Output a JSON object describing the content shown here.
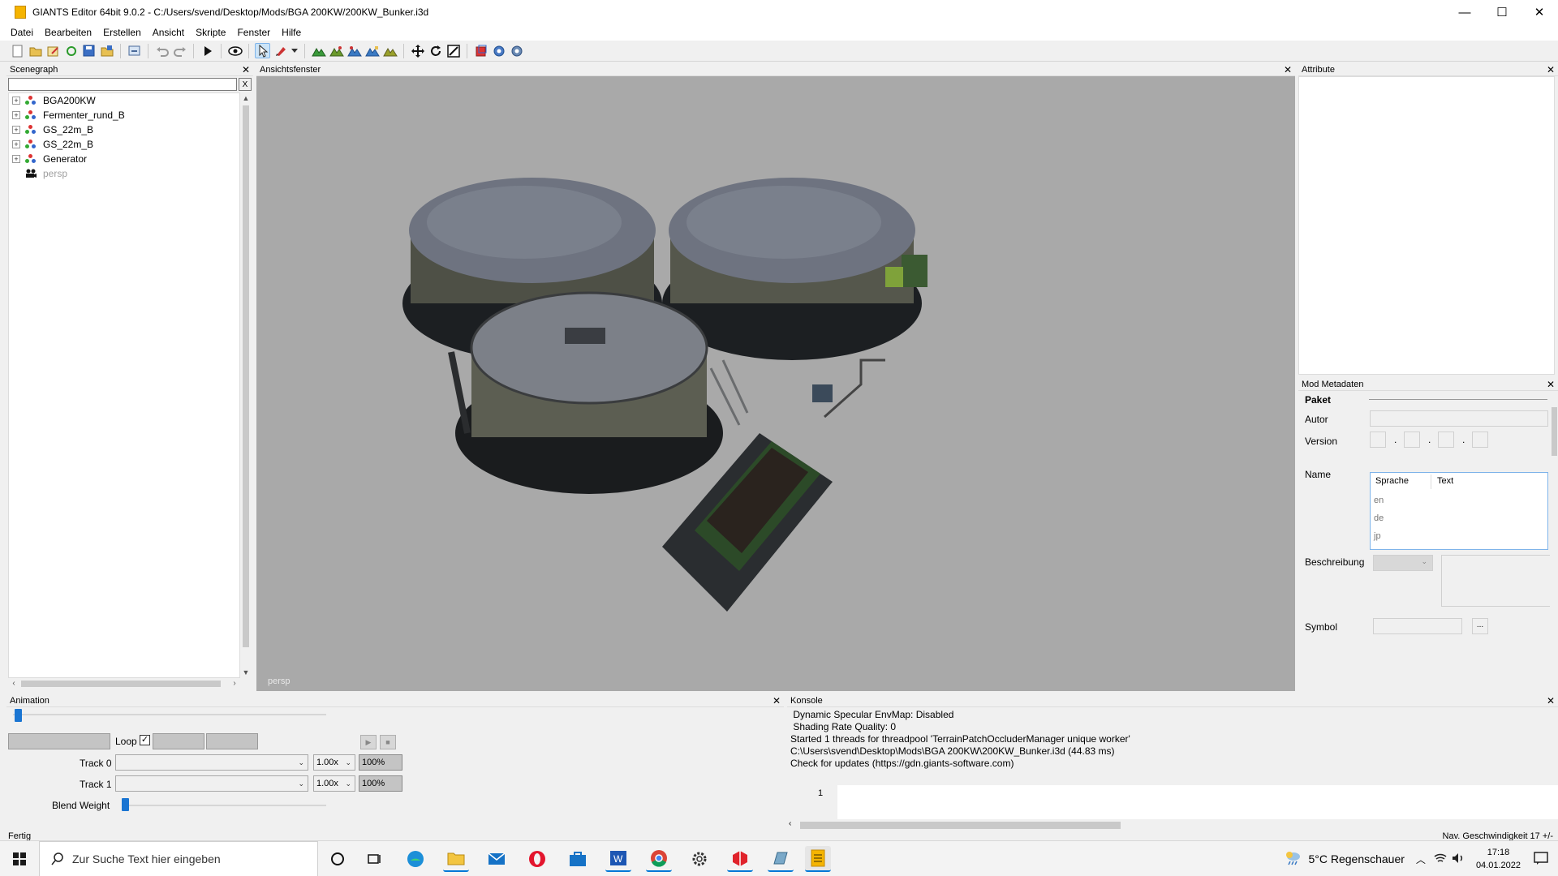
{
  "window": {
    "title": "GIANTS Editor 64bit 9.0.2 - C:/Users/svend/Desktop/Mods/BGA 200KW/200KW_Bunker.i3d",
    "minimize": "—",
    "maximize": "☐",
    "close": "✕"
  },
  "menu": [
    "Datei",
    "Bearbeiten",
    "Erstellen",
    "Ansicht",
    "Skripte",
    "Fenster",
    "Hilfe"
  ],
  "toolbar": {
    "icons": [
      "new-file-icon",
      "open-folder-icon",
      "edit-icon",
      "refresh-icon",
      "save-icon",
      "save-as-icon",
      "import-icon",
      "undo-icon",
      "redo-icon",
      "play-icon",
      "eye-icon",
      "select-icon",
      "paint-icon",
      "dropdown-icon",
      "terrain-icon-1",
      "terrain-icon-2",
      "terrain-icon-3",
      "terrain-icon-4",
      "terrain-icon-5",
      "move-icon",
      "rotate-icon",
      "scale-icon",
      "cube-icon",
      "gear-icon",
      "gear-alt-icon"
    ]
  },
  "scenegraph": {
    "title": "Scenegraph",
    "close": "✕",
    "filter_clear": "X",
    "items": [
      {
        "label": "BGA200KW",
        "expander": "+"
      },
      {
        "label": "Fermenter_rund_B",
        "expander": "+"
      },
      {
        "label": "GS_22m_B",
        "expander": "+"
      },
      {
        "label": "GS_22m_B",
        "expander": "+"
      },
      {
        "label": "Generator",
        "expander": "+"
      }
    ],
    "camera_item": "persp"
  },
  "viewport": {
    "title": "Ansichtsfenster",
    "close": "✕",
    "camera_label": "persp"
  },
  "attribute": {
    "title": "Attribute",
    "close": "✕"
  },
  "metadata": {
    "title": "Mod Metadaten",
    "close": "✕",
    "section": "Paket",
    "labels": {
      "autor": "Autor",
      "version": "Version",
      "name": "Name",
      "beschreibung": "Beschreibung",
      "symbol": "Symbol"
    },
    "version_separators": [
      ".",
      ".",
      "."
    ],
    "name_table": {
      "col_language": "Sprache",
      "col_text": "Text",
      "languages": [
        "en",
        "de",
        "jp"
      ]
    },
    "symbol_button": "..."
  },
  "animation": {
    "title": "Animation",
    "close": "✕",
    "loop_label": "Loop",
    "loop_checked": true,
    "track0_label": "Track 0",
    "track1_label": "Track 1",
    "track0_speed": "1.00x",
    "track1_speed": "1.00x",
    "track0_pct": "100%",
    "track1_pct": "100%",
    "blend_label": "Blend Weight",
    "time_slider": 0,
    "blend_slider": 0
  },
  "console": {
    "title": "Konsole",
    "close": "✕",
    "lines": [
      " Dynamic Specular EnvMap: Disabled",
      " Shading Rate Quality: 0",
      "Started 1 threads for threadpool 'TerrainPatchOccluderManager unique worker'",
      "C:\\Users\\svend\\Desktop\\Mods\\BGA 200KW\\200KW_Bunker.i3d (44.83 ms)",
      "Check for updates (https://gdn.giants-software.com)"
    ],
    "line_number": "1"
  },
  "status": {
    "left": "Fertig",
    "right": "Nav. Geschwindigkeit 17 +/-"
  },
  "taskbar": {
    "search_placeholder": "Zur Suche Text hier eingeben",
    "weather": "5°C  Regenschauer",
    "time": "17:18",
    "date": "04.01.2022"
  },
  "colors": {
    "viewport_bg": "#a9a9a9",
    "accent": "#0078d7",
    "slider": "#1a75d2"
  }
}
